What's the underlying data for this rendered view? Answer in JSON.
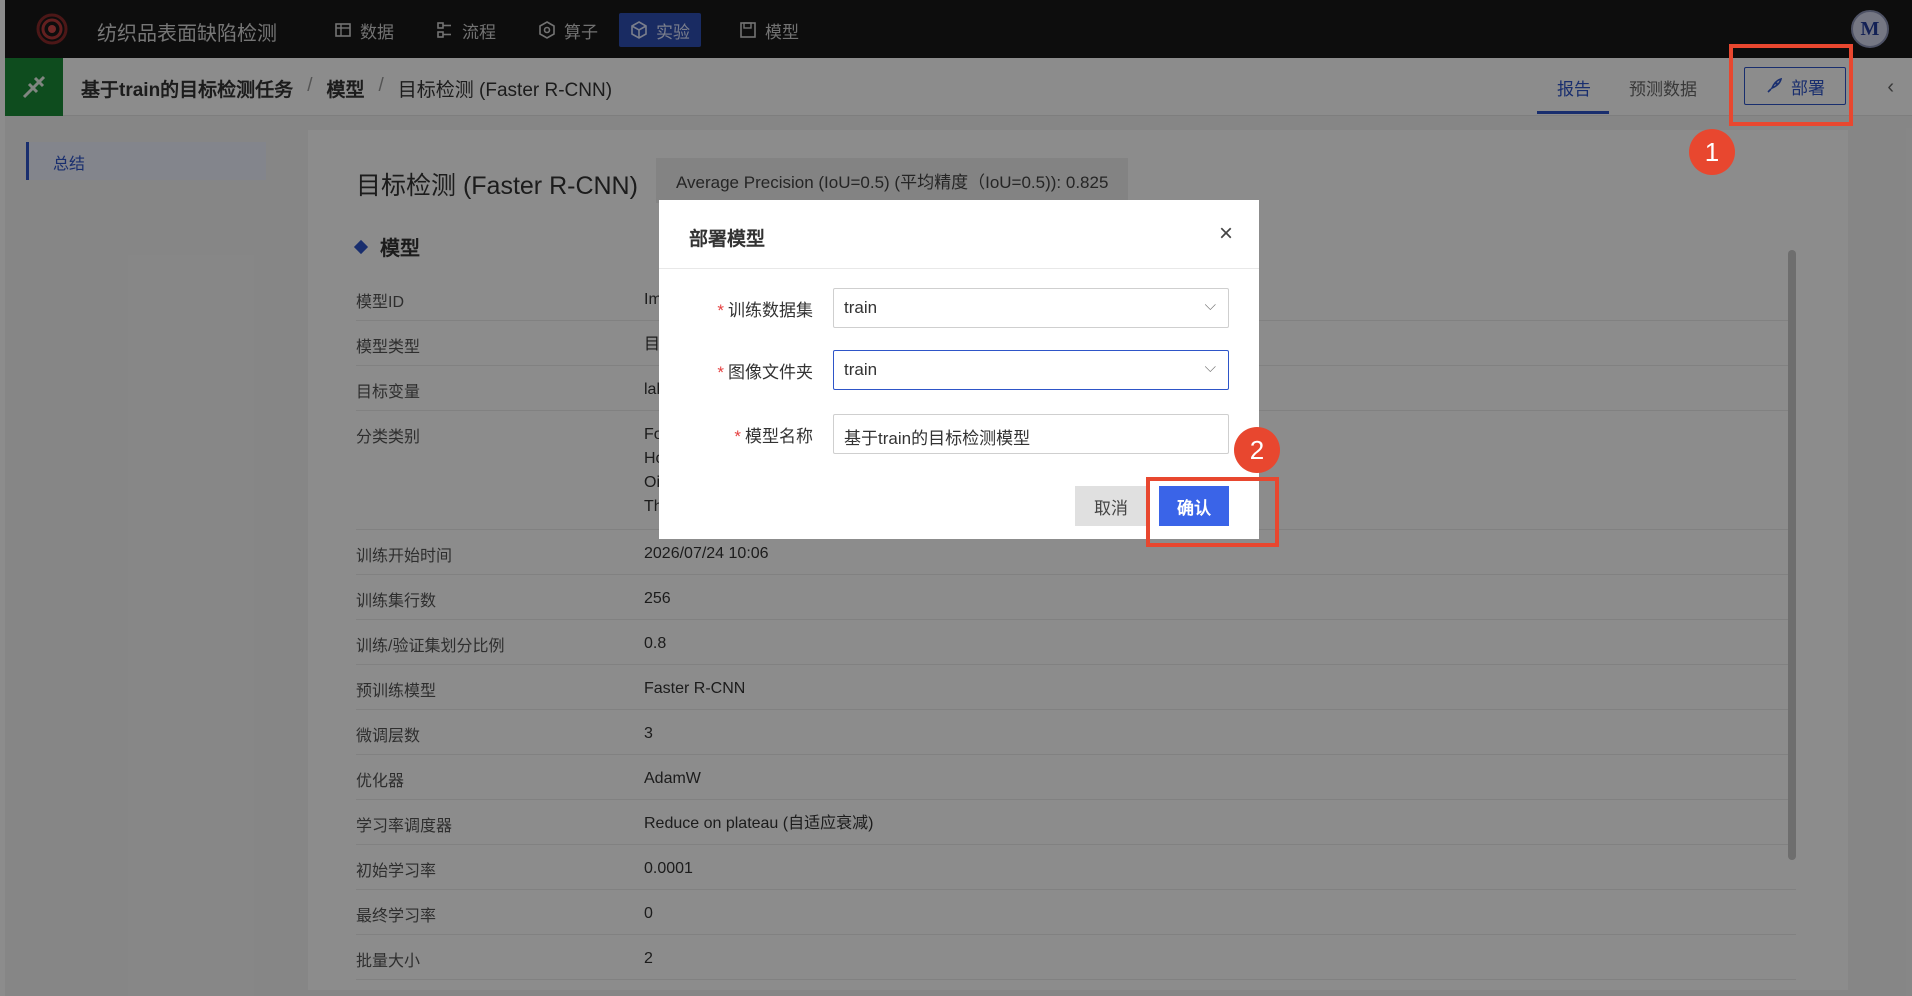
{
  "app": {
    "title": "纺织品表面缺陷检测",
    "avatar_initial": "M"
  },
  "nav": [
    {
      "label": "数据",
      "icon": "table-icon",
      "active": false
    },
    {
      "label": "流程",
      "icon": "flow-icon",
      "active": false
    },
    {
      "label": "算子",
      "icon": "operator-icon",
      "active": false
    },
    {
      "label": "实验",
      "icon": "cube-icon",
      "active": true
    },
    {
      "label": "模型",
      "icon": "save-icon",
      "active": false
    }
  ],
  "breadcrumb": {
    "task": "基于train的目标检测任务",
    "sep1": "/",
    "section": "模型",
    "sep2": "/",
    "current": "目标检测 (Faster R-CNN)"
  },
  "tabs": {
    "report": "报告",
    "predict": "预测数据"
  },
  "deploy_button": "部署",
  "sidebar": {
    "summary": "总结"
  },
  "report": {
    "title": "目标检测 (Faster R-CNN)",
    "metric": "Average Precision (IoU=0.5) (平均精度（IoU=0.5)): 0.825",
    "section": "模型",
    "rows": [
      {
        "key": "模型ID",
        "value": "Im"
      },
      {
        "key": "模型类型",
        "value": "目"
      },
      {
        "key": "目标变量",
        "value": "lal"
      },
      {
        "key": "分类类别",
        "value": "Fo\nHo\nOi\nTh"
      },
      {
        "key": "训练开始时间",
        "value": "2026/07/24 10:06"
      },
      {
        "key": "训练集行数",
        "value": "256"
      },
      {
        "key": "训练/验证集划分比例",
        "value": "0.8"
      },
      {
        "key": "预训练模型",
        "value": "Faster R-CNN"
      },
      {
        "key": "微调层数",
        "value": "3"
      },
      {
        "key": "优化器",
        "value": "AdamW"
      },
      {
        "key": "学习率调度器",
        "value": "Reduce on plateau (自适应衰减)"
      },
      {
        "key": "初始学习率",
        "value": "0.0001"
      },
      {
        "key": "最终学习率",
        "value": "0"
      },
      {
        "key": "批量大小",
        "value": "2"
      }
    ]
  },
  "modal": {
    "title": "部署模型",
    "close": "×",
    "fields": {
      "dataset_label": "训练数据集",
      "dataset_value": "train",
      "folder_label": "图像文件夹",
      "folder_value": "train",
      "name_label": "模型名称",
      "name_value": "基于train的目标检测模型"
    },
    "required_mark": "*",
    "cancel": "取消",
    "confirm": "确认"
  },
  "annotations": {
    "step1": "1",
    "step2": "2",
    "color": "#e8472f"
  },
  "colors": {
    "accent": "#2e55c8",
    "topbar": "#181818",
    "task_icon": "#1b8b37"
  }
}
